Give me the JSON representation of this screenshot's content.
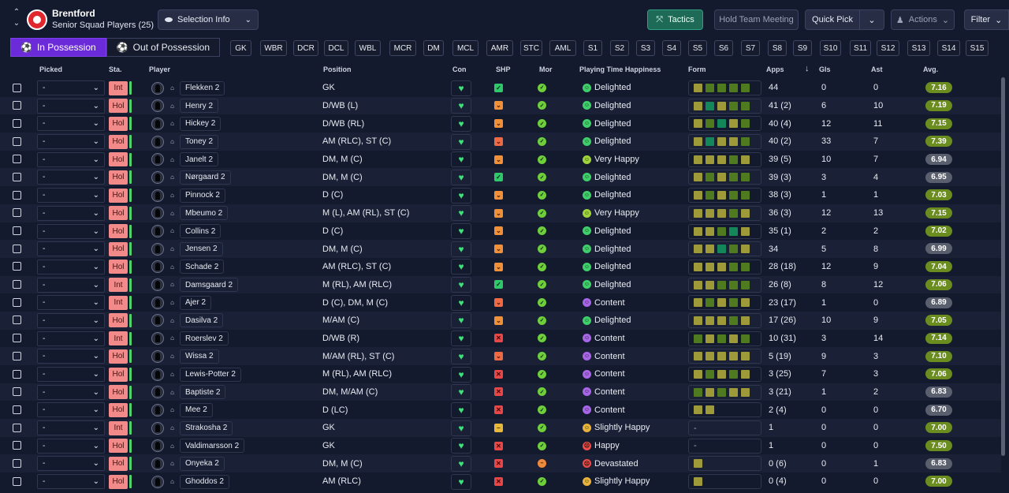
{
  "club": {
    "name": "Brentford",
    "subtitle": "Senior Squad Players (25)"
  },
  "selection_info": "Selection Info",
  "toolbar": {
    "tactics": "Tactics",
    "hold_meeting": "Hold Team Meeting",
    "quick_pick": "Quick Pick",
    "actions": "Actions",
    "filter": "Filter"
  },
  "possession_tabs": [
    {
      "label": "In Possession",
      "active": true
    },
    {
      "label": "Out of Possession",
      "active": false
    }
  ],
  "position_filters": [
    "GK",
    "WBR",
    "DCR",
    "DCL",
    "WBL",
    "MCR",
    "DM",
    "MCL",
    "AMR",
    "STC",
    "AML",
    "S1",
    "S2",
    "S3",
    "S4",
    "S5",
    "S6",
    "S7",
    "S8",
    "S9",
    "S10",
    "S11",
    "S12",
    "S13",
    "S14",
    "S15"
  ],
  "headers": {
    "picked": "Picked",
    "sta": "Sta.",
    "player": "Player",
    "position": "Position",
    "con": "Con",
    "shp": "SHP",
    "mor": "Mor",
    "happiness": "Playing Time Happiness",
    "form": "Form",
    "apps": "Apps",
    "sort_arrow": "↓",
    "gls": "Gls",
    "ast": "Ast",
    "avg": "Avg."
  },
  "colors": {
    "accent_purple": "#6b2bd9",
    "tactics_green": "#1d6a56",
    "form_olive": "#9e9a3a",
    "form_green": "#4f7a1f",
    "form_teal": "#13865a"
  },
  "players": [
    {
      "picked": "-",
      "sta": "Int",
      "name": "Flekken 2",
      "pos": "GK",
      "shp": "ok",
      "mor": "good",
      "happy": "Delighted",
      "form": [
        "o",
        "g",
        "g",
        "g",
        "g"
      ],
      "apps": "44",
      "gls": "0",
      "ast": "0",
      "avg": "7.16"
    },
    {
      "picked": "-",
      "sta": "Hol",
      "name": "Henry 2",
      "pos": "D/WB (L)",
      "shp": "warn",
      "mor": "good",
      "happy": "Delighted",
      "form": [
        "o",
        "t",
        "o",
        "g",
        "g"
      ],
      "apps": "41 (2)",
      "gls": "6",
      "ast": "10",
      "avg": "7.19"
    },
    {
      "picked": "-",
      "sta": "Hol",
      "name": "Hickey 2",
      "pos": "D/WB (RL)",
      "shp": "warn",
      "mor": "good",
      "happy": "Delighted",
      "form": [
        "o",
        "g",
        "t",
        "o",
        "g"
      ],
      "apps": "40 (4)",
      "gls": "12",
      "ast": "11",
      "avg": "7.15"
    },
    {
      "picked": "-",
      "sta": "Hol",
      "name": "Toney 2",
      "pos": "AM (RLC), ST (C)",
      "shp": "warn2",
      "mor": "good",
      "happy": "Delighted",
      "form": [
        "o",
        "t",
        "o",
        "o",
        "g"
      ],
      "apps": "40 (2)",
      "gls": "33",
      "ast": "7",
      "avg": "7.39"
    },
    {
      "picked": "-",
      "sta": "Hol",
      "name": "Janelt 2",
      "pos": "DM, M (C)",
      "shp": "warn",
      "mor": "good",
      "happy": "Very Happy",
      "form": [
        "o",
        "o",
        "o",
        "g",
        "o"
      ],
      "apps": "39 (5)",
      "gls": "10",
      "ast": "7",
      "avg": "6.94"
    },
    {
      "picked": "-",
      "sta": "Hol",
      "name": "Nørgaard 2",
      "pos": "DM, M (C)",
      "shp": "ok",
      "mor": "good",
      "happy": "Delighted",
      "form": [
        "o",
        "g",
        "o",
        "g",
        "g"
      ],
      "apps": "39 (3)",
      "gls": "3",
      "ast": "4",
      "avg": "6.95"
    },
    {
      "picked": "-",
      "sta": "Hol",
      "name": "Pinnock 2",
      "pos": "D (C)",
      "shp": "warn",
      "mor": "good",
      "happy": "Delighted",
      "form": [
        "o",
        "g",
        "o",
        "g",
        "g"
      ],
      "apps": "38 (3)",
      "gls": "1",
      "ast": "1",
      "avg": "7.03"
    },
    {
      "picked": "-",
      "sta": "Hol",
      "name": "Mbeumo 2",
      "pos": "M (L), AM (RL), ST (C)",
      "shp": "warn",
      "mor": "good",
      "happy": "Very Happy",
      "form": [
        "o",
        "o",
        "o",
        "g",
        "o"
      ],
      "apps": "36 (3)",
      "gls": "12",
      "ast": "13",
      "avg": "7.15"
    },
    {
      "picked": "-",
      "sta": "Hol",
      "name": "Collins 2",
      "pos": "D (C)",
      "shp": "warn",
      "mor": "good",
      "happy": "Delighted",
      "form": [
        "o",
        "o",
        "g",
        "t",
        "o"
      ],
      "apps": "35 (1)",
      "gls": "2",
      "ast": "2",
      "avg": "7.02"
    },
    {
      "picked": "-",
      "sta": "Hol",
      "name": "Jensen 2",
      "pos": "DM, M (C)",
      "shp": "warn",
      "mor": "good",
      "happy": "Delighted",
      "form": [
        "o",
        "o",
        "t",
        "g",
        "o"
      ],
      "apps": "34",
      "gls": "5",
      "ast": "8",
      "avg": "6.99"
    },
    {
      "picked": "-",
      "sta": "Hol",
      "name": "Schade 2",
      "pos": "AM (RLC), ST (C)",
      "shp": "warn",
      "mor": "good",
      "happy": "Delighted",
      "form": [
        "o",
        "o",
        "o",
        "g",
        "g"
      ],
      "apps": "28 (18)",
      "gls": "12",
      "ast": "9",
      "avg": "7.04"
    },
    {
      "picked": "-",
      "sta": "Int",
      "name": "Damsgaard 2",
      "pos": "M (RL), AM (RLC)",
      "shp": "ok",
      "mor": "good",
      "happy": "Delighted",
      "form": [
        "o",
        "o",
        "g",
        "g",
        "g"
      ],
      "apps": "26 (8)",
      "gls": "8",
      "ast": "12",
      "avg": "7.06"
    },
    {
      "picked": "-",
      "sta": "Int",
      "name": "Ajer 2",
      "pos": "D (C), DM, M (C)",
      "shp": "warn2",
      "mor": "good",
      "happy": "Content",
      "form": [
        "o",
        "g",
        "o",
        "g",
        "o"
      ],
      "apps": "23 (17)",
      "gls": "1",
      "ast": "0",
      "avg": "6.89"
    },
    {
      "picked": "-",
      "sta": "Hol",
      "name": "Dasilva 2",
      "pos": "M/AM (C)",
      "shp": "warn",
      "mor": "good",
      "happy": "Delighted",
      "form": [
        "o",
        "o",
        "o",
        "g",
        "o"
      ],
      "apps": "17 (26)",
      "gls": "10",
      "ast": "9",
      "avg": "7.05"
    },
    {
      "picked": "-",
      "sta": "Int",
      "name": "Roerslev 2",
      "pos": "D/WB (R)",
      "shp": "bad",
      "mor": "good",
      "happy": "Content",
      "form": [
        "g",
        "o",
        "g",
        "o",
        "g"
      ],
      "apps": "10 (31)",
      "gls": "3",
      "ast": "14",
      "avg": "7.14"
    },
    {
      "picked": "-",
      "sta": "Hol",
      "name": "Wissa 2",
      "pos": "M/AM (RL), ST (C)",
      "shp": "warn2",
      "mor": "good",
      "happy": "Content",
      "form": [
        "o",
        "o",
        "o",
        "o",
        "o"
      ],
      "apps": "5 (19)",
      "gls": "9",
      "ast": "3",
      "avg": "7.10"
    },
    {
      "picked": "-",
      "sta": "Hol",
      "name": "Lewis-Potter 2",
      "pos": "M (RL), AM (RLC)",
      "shp": "bad",
      "mor": "good",
      "happy": "Content",
      "form": [
        "o",
        "g",
        "o",
        "g",
        "o"
      ],
      "apps": "3 (25)",
      "gls": "7",
      "ast": "3",
      "avg": "7.06"
    },
    {
      "picked": "-",
      "sta": "Hol",
      "name": "Baptiste 2",
      "pos": "DM, M/AM (C)",
      "shp": "bad",
      "mor": "good",
      "happy": "Content",
      "form": [
        "g",
        "o",
        "g",
        "o",
        "o"
      ],
      "apps": "3 (21)",
      "gls": "1",
      "ast": "2",
      "avg": "6.83"
    },
    {
      "picked": "-",
      "sta": "Hol",
      "name": "Mee 2",
      "pos": "D (LC)",
      "shp": "bad",
      "mor": "good",
      "happy": "Content",
      "form": [
        "o",
        "o"
      ],
      "apps": "2 (4)",
      "gls": "0",
      "ast": "0",
      "avg": "6.70"
    },
    {
      "picked": "-",
      "sta": "Int",
      "name": "Strakosha 2",
      "pos": "GK",
      "shp": "mid",
      "mor": "good",
      "happy": "Slightly Happy",
      "form": [],
      "apps": "1",
      "gls": "0",
      "ast": "0",
      "avg": "7.00"
    },
    {
      "picked": "-",
      "sta": "Hol",
      "name": "Valdimarsson 2",
      "pos": "GK",
      "shp": "bad",
      "mor": "good",
      "happy": "Happy",
      "form": [],
      "apps": "1",
      "gls": "0",
      "ast": "0",
      "avg": "7.50"
    },
    {
      "picked": "-",
      "sta": "Hol",
      "name": "Onyeka 2",
      "pos": "DM, M (C)",
      "shp": "bad",
      "mor": "low",
      "happy": "Devastated",
      "form": [
        "o"
      ],
      "apps": "0 (6)",
      "gls": "0",
      "ast": "1",
      "avg": "6.83"
    },
    {
      "picked": "-",
      "sta": "Hol",
      "name": "Ghoddos 2",
      "pos": "AM (RLC)",
      "shp": "bad",
      "mor": "good",
      "happy": "Slightly Happy",
      "form": [
        "o"
      ],
      "apps": "0 (4)",
      "gls": "0",
      "ast": "0",
      "avg": "7.00"
    }
  ]
}
